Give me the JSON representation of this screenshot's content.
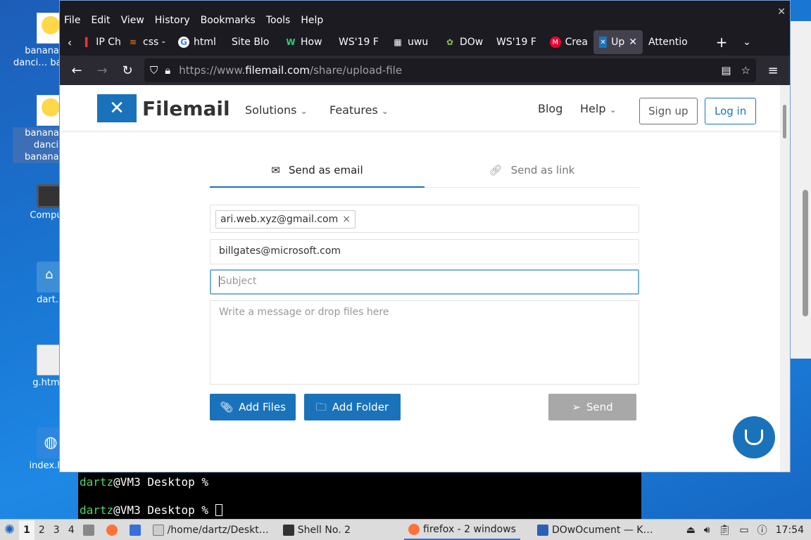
{
  "desktop": {
    "icons": [
      {
        "label": "banana-c… danci… banan…"
      },
      {
        "label": "banana-c… danci… banana.g…"
      },
      {
        "label": "Compu…"
      },
      {
        "label": "dart…"
      },
      {
        "label": "g.htm…"
      },
      {
        "label": "index.h…"
      }
    ]
  },
  "terminal": {
    "line1_user": "dartz",
    "line1_rest": "@VM3 Desktop %",
    "line2_user": "dartz",
    "line2_rest": "@VM3 Desktop %"
  },
  "browser": {
    "menu": [
      "File",
      "Edit",
      "View",
      "History",
      "Bookmarks",
      "Tools",
      "Help"
    ],
    "tabs": [
      {
        "label": "IP Ch",
        "icon": "tab-red-icon"
      },
      {
        "label": "css -",
        "icon": "stack-icon"
      },
      {
        "label": "html",
        "icon": "google-icon"
      },
      {
        "label": "Site Blo",
        "icon": ""
      },
      {
        "label": "How",
        "icon": "w-icon"
      },
      {
        "label": "WS'19 F",
        "icon": ""
      },
      {
        "label": "uwu",
        "icon": "grid-icon"
      },
      {
        "label": "DOw",
        "icon": "leaf-icon"
      },
      {
        "label": "WS'19 F",
        "icon": ""
      },
      {
        "label": "Crea",
        "icon": "m-icon"
      },
      {
        "label": "Up",
        "icon": "filemail-icon"
      },
      {
        "label": "Attentio",
        "icon": ""
      }
    ],
    "url_prefix": "https://www.",
    "url_domain": "filemail.com",
    "url_path": "/share/upload-file"
  },
  "site": {
    "brand": "Filemail",
    "nav": {
      "solutions": "Solutions",
      "features": "Features",
      "blog": "Blog",
      "help": "Help"
    },
    "signup": "Sign up",
    "login": "Log in",
    "send_email_tab": "Send as email",
    "send_link_tab": "Send as link",
    "to_chip": "ari.web.xyz@gmail.com",
    "from_value": "billgates@microsoft.com",
    "subject_placeholder": "Subject",
    "message_placeholder": "Write a message or drop files here",
    "add_files": "Add Files",
    "add_folder": "Add Folder",
    "send": "Send",
    "brand_color": "#1a73ba"
  },
  "taskbar": {
    "workspaces": [
      "1",
      "2",
      "3",
      "4"
    ],
    "items": [
      {
        "label": "/home/dartz/Deskt…"
      },
      {
        "label": "Shell No. 2"
      },
      {
        "label": "firefox - 2 windows"
      },
      {
        "label": "DOwOcument — K…"
      }
    ],
    "clock": "17:54"
  }
}
